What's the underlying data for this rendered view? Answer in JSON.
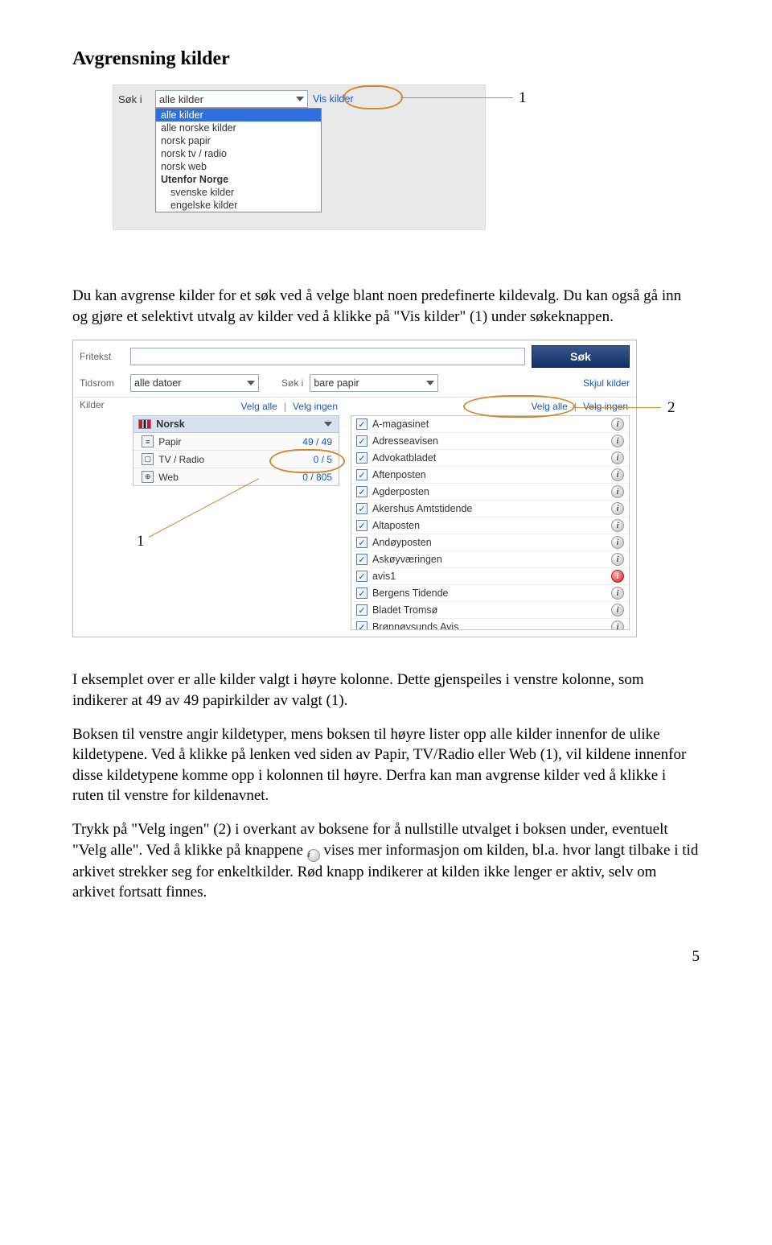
{
  "heading": "Avgrensning kilder",
  "para1": "Du kan avgrense kilder for et søk ved å velge blant noen predefinerte kildevalg. Du kan også gå inn og gjøre et selektivt utvalg av kilder ved å klikke på \"Vis kilder\" (1) under søkeknappen.",
  "para2": "I eksemplet over er alle kilder valgt i høyre kolonne. Dette gjenspeiles i venstre kolonne, som indikerer at 49 av 49 papirkilder av valgt (1).",
  "para3": "Boksen til venstre angir kildetyper, mens boksen til høyre lister opp alle kilder innenfor de ulike kildetypene. Ved å klikke på lenken ved siden av Papir, TV/Radio eller Web (1), vil kildene innenfor disse kildetypene komme opp i kolonnen til høyre. Derfra kan man avgrense kilder ved å klikke i ruten til venstre for kildenavnet.",
  "para4_a": "Trykk på \"Velg ingen\" (2) i overkant av boksene for å nullstille utvalget i boksen under, eventuelt \"Velg alle\". Ved å klikke på knappene ",
  "para4_b": " vises mer informasjon om kilden, bl.a. hvor langt tilbake i tid arkivet strekker seg for enkeltkilder. Rød knapp indikerer at kilden ikke lenger er aktiv, selv om arkivet fortsatt finnes.",
  "callout_1": "1",
  "callout_2": "2",
  "shot1": {
    "soki_label": "Søk i",
    "selected": "alle kilder",
    "vis_kilder": "Vis kilder",
    "options": [
      {
        "label": "alle kilder",
        "selected": true
      },
      {
        "label": "alle norske kilder"
      },
      {
        "label": "norsk papir"
      },
      {
        "label": "norsk tv / radio"
      },
      {
        "label": "norsk web"
      },
      {
        "label": "Utenfor Norge",
        "group": true
      },
      {
        "label": "svenske kilder",
        "indent": true
      },
      {
        "label": "engelske kilder",
        "indent": true
      }
    ]
  },
  "shot2": {
    "fritekst": "Fritekst",
    "sok_btn": "Søk",
    "tidsrom": "Tidsrom",
    "tidsrom_val": "alle datoer",
    "soki": "Søk i",
    "soki_val": "bare papir",
    "skjul": "Skjul kilder",
    "kilder": "Kilder",
    "velg_alle": "Velg alle",
    "velg_ingen": "Velg ingen",
    "norsk": "Norsk",
    "types": [
      {
        "icon": "≡",
        "name": "Papir",
        "count": "49 / 49"
      },
      {
        "icon": "▢",
        "name": "TV / Radio",
        "count": "0 / 5"
      },
      {
        "icon": "⊕",
        "name": "Web",
        "count": "0 / 805"
      }
    ],
    "sources": [
      {
        "name": "A-magasinet"
      },
      {
        "name": "Adresseavisen"
      },
      {
        "name": "Advokatbladet"
      },
      {
        "name": "Aftenposten"
      },
      {
        "name": "Agderposten"
      },
      {
        "name": "Akershus Amtstidende"
      },
      {
        "name": "Altaposten"
      },
      {
        "name": "Andøyposten"
      },
      {
        "name": "Askøyværingen"
      },
      {
        "name": "avis1",
        "red": true
      },
      {
        "name": "Bergens Tidende"
      },
      {
        "name": "Bladet Tromsø"
      },
      {
        "name": "Brønnøysunds Avis"
      }
    ]
  },
  "page_number": "5"
}
